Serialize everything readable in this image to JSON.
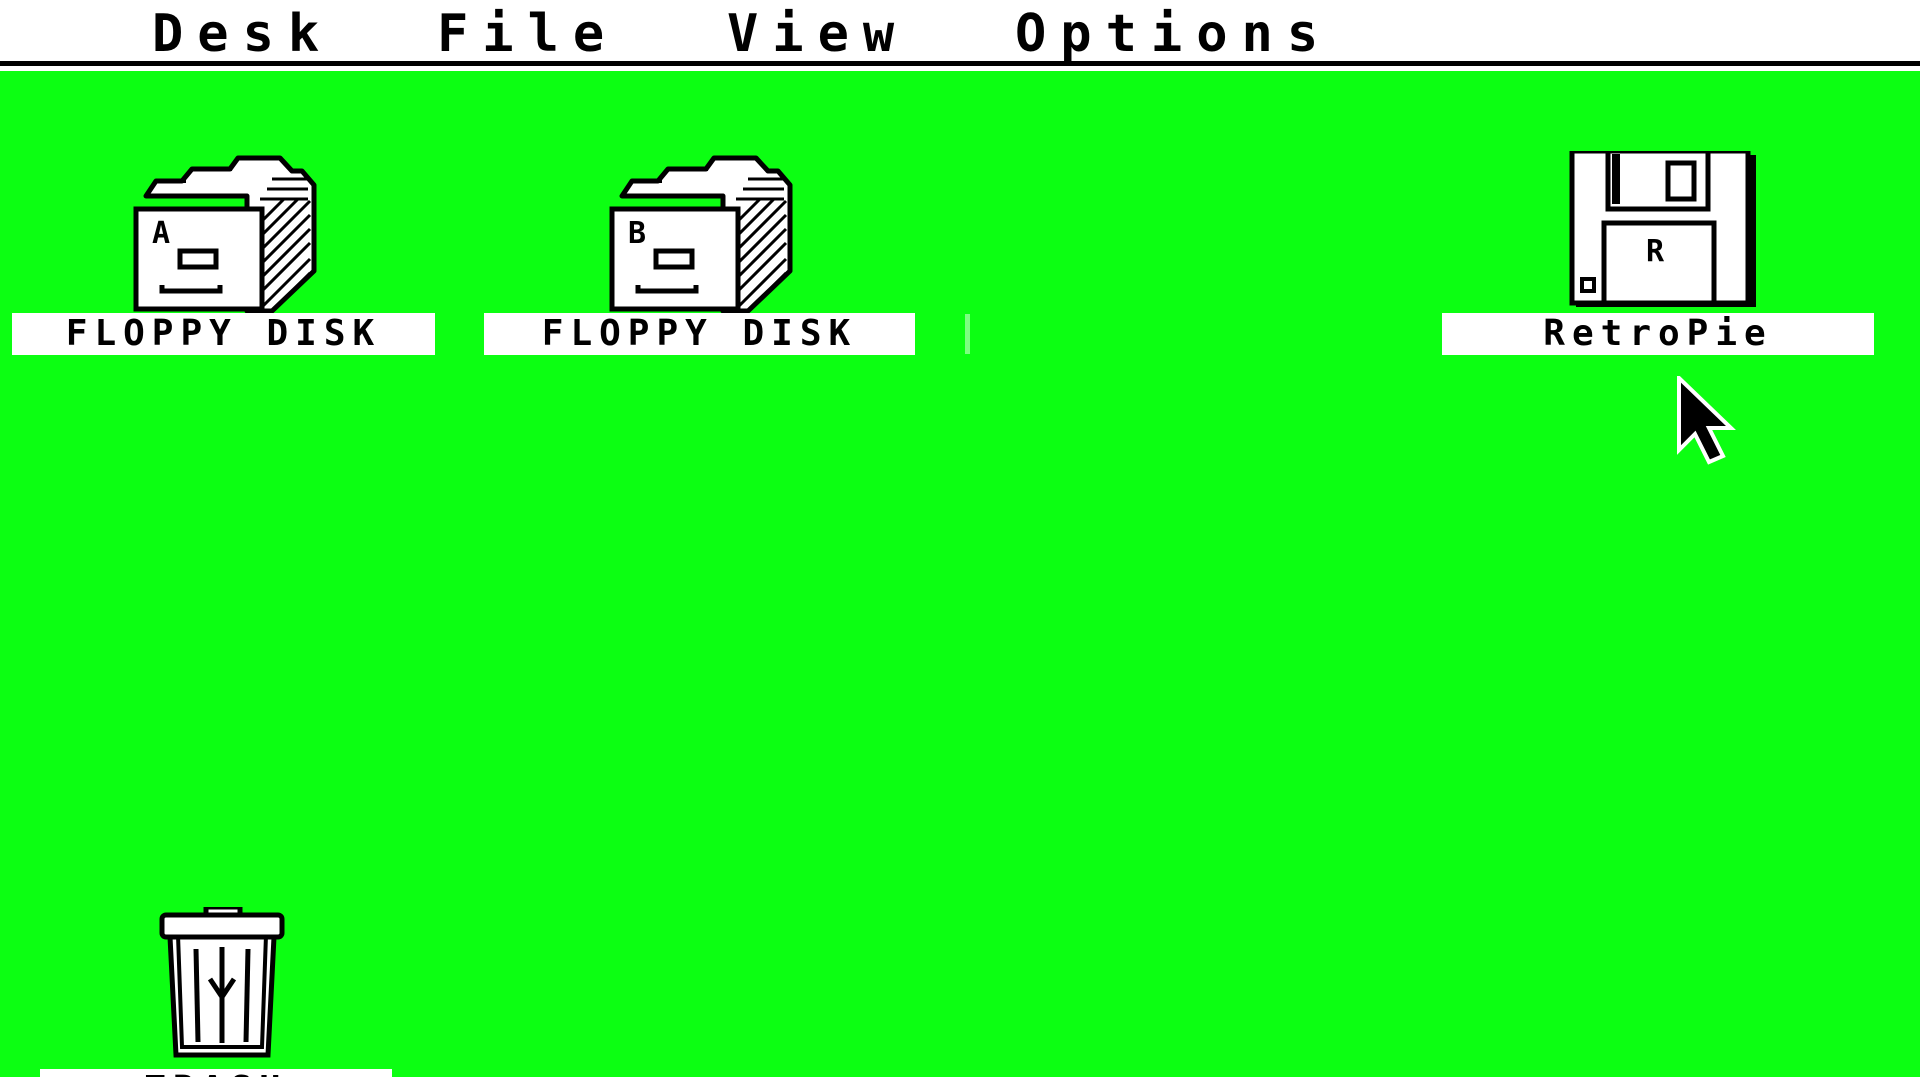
{
  "menubar": {
    "items": [
      {
        "id": "desk",
        "label": "Desk"
      },
      {
        "id": "file",
        "label": "File"
      },
      {
        "id": "view",
        "label": "View"
      },
      {
        "id": "options",
        "label": "Options"
      }
    ]
  },
  "desktop": {
    "background_color": "#0cff12",
    "icons": [
      {
        "id": "drive-a",
        "label": "FLOPPY DISK",
        "drive_letter": "A",
        "icon": "file-cabinet-icon"
      },
      {
        "id": "drive-b",
        "label": "FLOPPY DISK",
        "drive_letter": "B",
        "icon": "file-cabinet-icon"
      },
      {
        "id": "retropie-drive",
        "label": "RetroPie",
        "drive_letter": "R",
        "icon": "floppy-disk-icon"
      },
      {
        "id": "trash",
        "label": "TRASH",
        "icon": "trash-can-icon"
      }
    ]
  },
  "cursor": {
    "icon": "arrow-pointer-icon"
  }
}
